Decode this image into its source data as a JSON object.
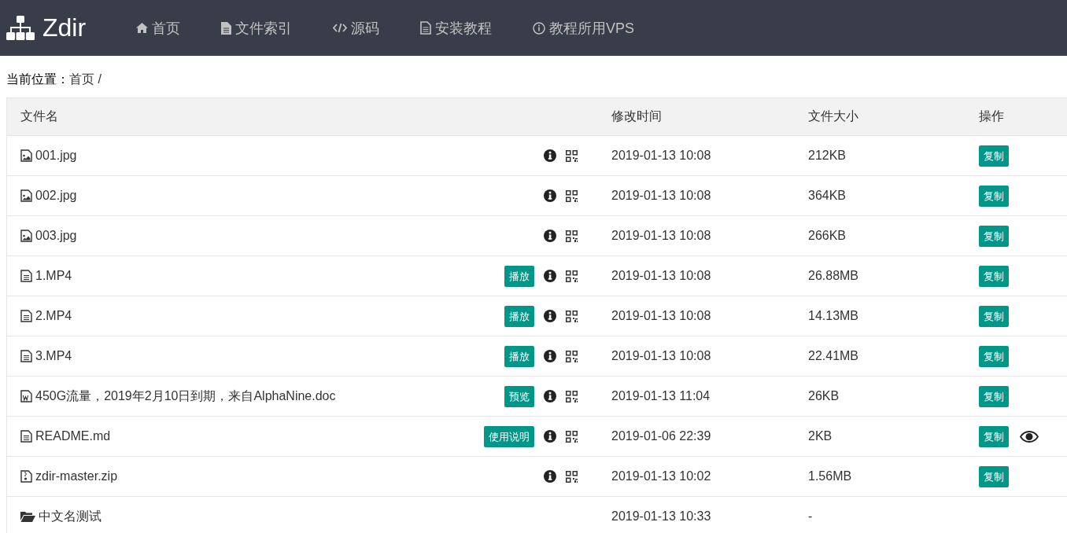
{
  "nav": {
    "brand": "Zdir",
    "items": [
      {
        "label": "首页"
      },
      {
        "label": "文件索引"
      },
      {
        "label": "源码"
      },
      {
        "label": "安装教程"
      },
      {
        "label": "教程所用VPS"
      }
    ]
  },
  "breadcrumb": {
    "label": "当前位置：",
    "path": "首页 /"
  },
  "table": {
    "columns": [
      "文件名",
      "修改时间",
      "文件大小",
      "操作"
    ],
    "rows": [
      {
        "kind": "image",
        "name": "001.jpg",
        "modified": "2019-01-13 10:08",
        "size": "212KB",
        "copy": "复制",
        "viewable": false
      },
      {
        "kind": "image",
        "name": "002.jpg",
        "modified": "2019-01-13 10:08",
        "size": "364KB",
        "copy": "复制",
        "viewable": false
      },
      {
        "kind": "image",
        "name": "003.jpg",
        "modified": "2019-01-13 10:08",
        "size": "266KB",
        "copy": "复制",
        "viewable": false
      },
      {
        "kind": "text",
        "name": "1.MP4",
        "action": "播放",
        "modified": "2019-01-13 10:08",
        "size": "26.88MB",
        "copy": "复制",
        "viewable": false
      },
      {
        "kind": "text",
        "name": "2.MP4",
        "action": "播放",
        "modified": "2019-01-13 10:08",
        "size": "14.13MB",
        "copy": "复制",
        "viewable": false
      },
      {
        "kind": "text",
        "name": "3.MP4",
        "action": "播放",
        "modified": "2019-01-13 10:08",
        "size": "22.41MB",
        "copy": "复制",
        "viewable": false
      },
      {
        "kind": "word",
        "name": "450G流量，2019年2月10日到期，来自AlphaNine.doc",
        "action": "预览",
        "modified": "2019-01-13 11:04",
        "size": "26KB",
        "copy": "复制",
        "viewable": false
      },
      {
        "kind": "text",
        "name": "README.md",
        "action": "使用说明",
        "modified": "2019-01-06 22:39",
        "size": "2KB",
        "copy": "复制",
        "viewable": true
      },
      {
        "kind": "zip",
        "name": "zdir-master.zip",
        "modified": "2019-01-13 10:02",
        "size": "1.56MB",
        "copy": "复制",
        "viewable": false
      },
      {
        "kind": "folder",
        "name": "中文名测试",
        "modified": "2019-01-13 10:33",
        "size": "-"
      }
    ]
  }
}
